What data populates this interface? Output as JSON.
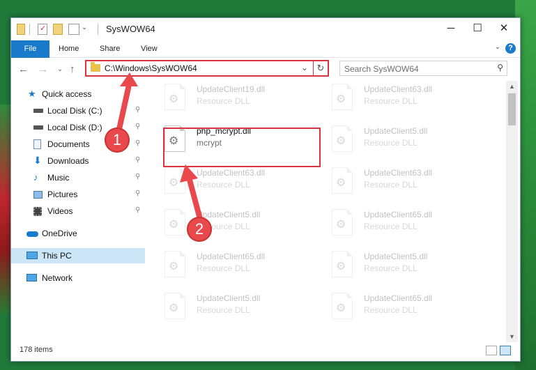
{
  "window": {
    "title": "SysWOW64",
    "minimize_glyph": "─",
    "maximize_glyph": "☐",
    "close_glyph": "✕"
  },
  "ribbon": {
    "tabs": [
      {
        "label": "File"
      },
      {
        "label": "Home"
      },
      {
        "label": "Share"
      },
      {
        "label": "View"
      }
    ],
    "help_glyph": "?",
    "collapse_glyph": "⌄"
  },
  "navigation": {
    "back_glyph": "←",
    "forward_glyph": "→",
    "recent_glyph": "⌄",
    "up_glyph": "↑"
  },
  "address": {
    "path": "C:\\Windows\\SysWOW64",
    "dropdown_glyph": "⌄",
    "refresh_glyph": "↻"
  },
  "search": {
    "placeholder": "Search SysWOW64",
    "icon_glyph": "⚲"
  },
  "nav_pane": {
    "items": [
      {
        "label": "Quick access",
        "icon": "star-icon",
        "pinned": false
      },
      {
        "label": "Local Disk (C:)",
        "icon": "drive-icon",
        "pinned": true
      },
      {
        "label": "Local Disk (D:)",
        "icon": "drive-icon",
        "pinned": true
      },
      {
        "label": "Documents",
        "icon": "documents-icon",
        "pinned": true
      },
      {
        "label": "Downloads",
        "icon": "download-icon",
        "pinned": true
      },
      {
        "label": "Music",
        "icon": "music-icon",
        "pinned": true
      },
      {
        "label": "Pictures",
        "icon": "pictures-icon",
        "pinned": true
      },
      {
        "label": "Videos",
        "icon": "videos-icon",
        "pinned": true
      },
      {
        "label": "OneDrive",
        "icon": "cloud-icon",
        "pinned": false
      },
      {
        "label": "This PC",
        "icon": "computer-icon",
        "pinned": false,
        "selected": true
      },
      {
        "label": "Network",
        "icon": "network-icon",
        "pinned": false
      }
    ],
    "pin_glyph": "📌"
  },
  "files": {
    "items": [
      {
        "name": "UpdateClient19.dll",
        "type": "Resource DLL",
        "faded": true
      },
      {
        "name": "UpdateClient63.dll",
        "type": "Resource DLL",
        "faded": true
      },
      {
        "name": "php_mcrypt.dll",
        "type": "mcrypt",
        "faded": false
      },
      {
        "name": "UpdateClient5.dll",
        "type": "Resource DLL",
        "faded": true
      },
      {
        "name": "UpdateClient63.dll",
        "type": "Resource DLL",
        "faded": true
      },
      {
        "name": "UpdateClient63.dll",
        "type": "Resource DLL",
        "faded": true
      },
      {
        "name": "UpdateClient5.dll",
        "type": "Resource DLL",
        "faded": true
      },
      {
        "name": "UpdateClient65.dll",
        "type": "Resource DLL",
        "faded": true
      },
      {
        "name": "UpdateClient65.dll",
        "type": "Resource DLL",
        "faded": true
      },
      {
        "name": "UpdateClient5.dll",
        "type": "Resource DLL",
        "faded": true
      },
      {
        "name": "UpdateClient5.dll",
        "type": "Resource DLL",
        "faded": true
      },
      {
        "name": "UpdateClient65.dll",
        "type": "Resource DLL",
        "faded": true
      }
    ],
    "gear_glyph": "⚙"
  },
  "status": {
    "item_count": "178 items"
  },
  "annotations": {
    "step1": "1",
    "step2": "2",
    "color": "#e9484c"
  }
}
